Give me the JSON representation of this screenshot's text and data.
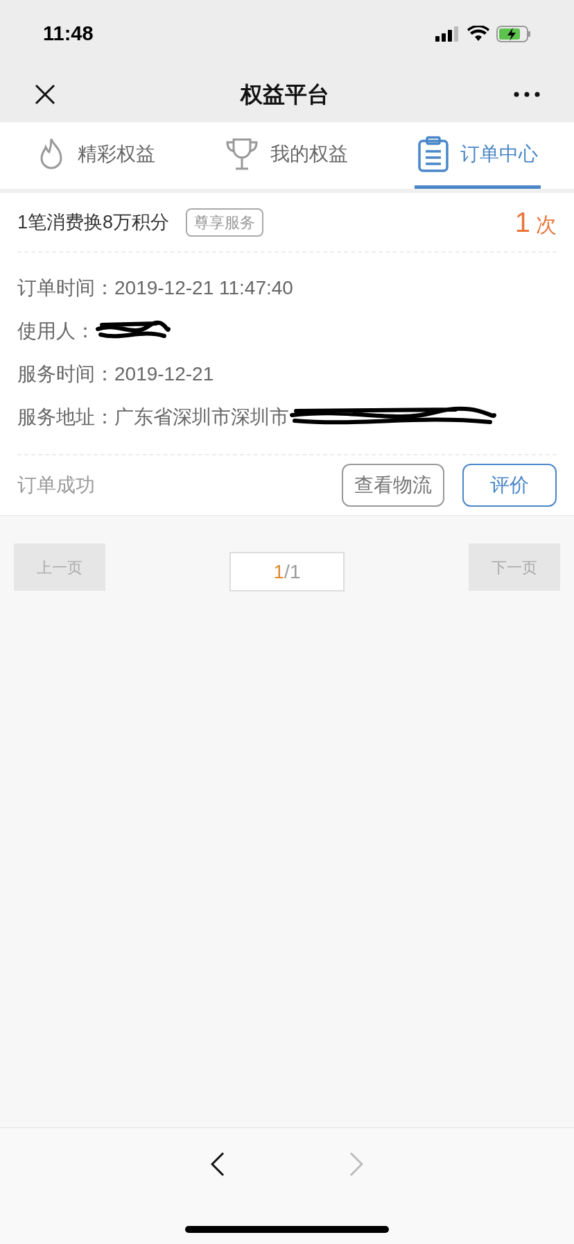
{
  "status_bar": {
    "time": "11:48"
  },
  "nav": {
    "title": "权益平台"
  },
  "tabs": [
    {
      "label": "精彩权益",
      "kind": "flame",
      "selected": false
    },
    {
      "label": "我的权益",
      "kind": "trophy",
      "selected": false
    },
    {
      "label": "订单中心",
      "kind": "clipboard",
      "selected": true
    }
  ],
  "order": {
    "title": "1笔消费换8万积分",
    "tag": "尊享服务",
    "count": "1",
    "count_unit": "次",
    "fields": [
      {
        "label": "订单时间：",
        "value": "2019-12-21 11:47:40",
        "redacted": false
      },
      {
        "label": "使用人：",
        "redacted": true
      },
      {
        "label": "服务时间：",
        "value": "2019-12-21",
        "redacted": false
      },
      {
        "label": "服务地址：",
        "value": "广东省深圳市深圳市",
        "redacted": true
      }
    ],
    "status": "订单成功",
    "buttons": [
      {
        "label": "查看物流",
        "primary": false
      },
      {
        "label": "评价",
        "primary": true
      }
    ]
  },
  "pager": {
    "prev": {
      "label": "上一页",
      "disabled": true
    },
    "current": "1",
    "total": "/1",
    "next": {
      "label": "下一页",
      "disabled": true
    }
  },
  "toolbar": {
    "back_disabled": false,
    "forward_disabled": true
  }
}
